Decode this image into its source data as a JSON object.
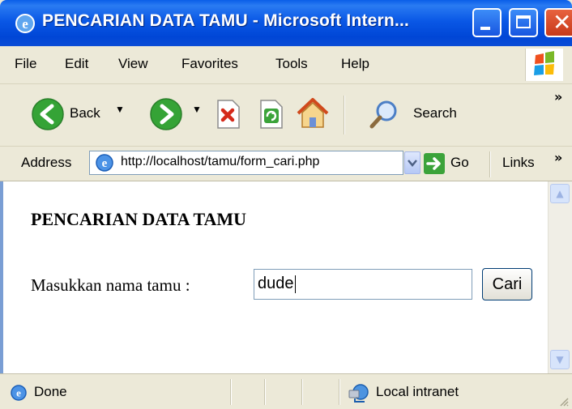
{
  "window": {
    "title": "PENCARIAN DATA TAMU - Microsoft Intern...",
    "minimize_label": "",
    "maximize_label": "",
    "close_label": "✕"
  },
  "menu": [
    "File",
    "Edit",
    "View",
    "Favorites",
    "Tools",
    "Help"
  ],
  "toolbar": {
    "back_label": "Back",
    "search_label": "Search",
    "overflow_label": "»"
  },
  "address": {
    "label": "Address",
    "url": "http://localhost/tamu/form_cari.php",
    "go_label": "Go",
    "links_label": "Links",
    "overflow_label": "»"
  },
  "page": {
    "heading": "PENCARIAN DATA TAMU",
    "field_label": "Masukkan nama tamu :",
    "field_value": "dude",
    "button_label": "Cari"
  },
  "status": {
    "text": "Done",
    "zone": "Local intranet"
  },
  "icons": {
    "ie": "ie-icon",
    "back": "back-arrow-icon",
    "forward": "forward-arrow-icon",
    "stop": "stop-icon",
    "refresh": "refresh-icon",
    "home": "home-icon",
    "search": "search-magnifier-icon",
    "go": "go-arrow-icon",
    "zone": "local-intranet-icon"
  },
  "colors": {
    "titlebar": "#0a58e6",
    "close_button": "#d4461f",
    "nav_green": "#35a336"
  }
}
